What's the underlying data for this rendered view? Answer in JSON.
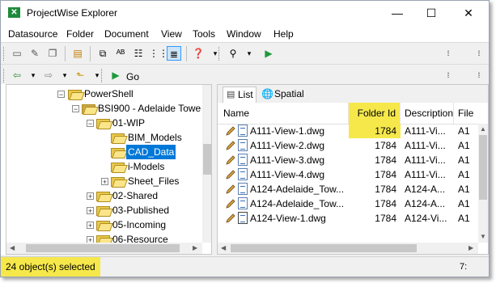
{
  "window": {
    "title": "ProjectWise Explorer",
    "minimize": "—",
    "maximize": "☐",
    "close": "✕"
  },
  "menu": [
    "Datasource",
    "Folder",
    "Document",
    "View",
    "Tools",
    "Window",
    "Help"
  ],
  "nav": {
    "go_label": "Go"
  },
  "tree": {
    "items": [
      {
        "label": "PowerShell",
        "expander": "−"
      },
      {
        "label": "BSI900 - Adelaide Towe",
        "expander": "−"
      },
      {
        "label": "01-WIP",
        "expander": "−"
      },
      {
        "label": "BIM_Models",
        "expander": ""
      },
      {
        "label": "CAD_Data",
        "expander": "",
        "selected": true
      },
      {
        "label": "i-Models",
        "expander": ""
      },
      {
        "label": "Sheet_Files",
        "expander": "+"
      },
      {
        "label": "02-Shared",
        "expander": "+"
      },
      {
        "label": "03-Published",
        "expander": "+"
      },
      {
        "label": "05-Incoming",
        "expander": "+"
      },
      {
        "label": "06-Resource",
        "expander": "+"
      }
    ]
  },
  "tabs": [
    {
      "label": "List"
    },
    {
      "label": "Spatial"
    }
  ],
  "columns": {
    "name": "Name",
    "folder_id": "Folder Id",
    "description": "Description",
    "file": "File"
  },
  "rows": [
    {
      "name": "A111-View-1.dwg",
      "folder_id": "1784",
      "description": "A111-Vi...",
      "file": "A1"
    },
    {
      "name": "A111-View-2.dwg",
      "folder_id": "1784",
      "description": "A111-Vi...",
      "file": "A1"
    },
    {
      "name": "A111-View-3.dwg",
      "folder_id": "1784",
      "description": "A111-Vi...",
      "file": "A1"
    },
    {
      "name": "A111-View-4.dwg",
      "folder_id": "1784",
      "description": "A111-Vi...",
      "file": "A1"
    },
    {
      "name": "A124-Adelaide_Tow...",
      "folder_id": "1784",
      "description": "A124-A...",
      "file": "A1"
    },
    {
      "name": "A124-Adelaide_Tow...",
      "folder_id": "1784",
      "description": "A124-A...",
      "file": "A1"
    },
    {
      "name": "A124-View-1.dwg",
      "folder_id": "1784",
      "description": "A124-Vi...",
      "file": "A1"
    }
  ],
  "status": {
    "text": "24 object(s) selected",
    "right": "7:"
  },
  "colors": {
    "highlight": "#f6e84b",
    "selection": "#0078d7",
    "accent_green": "#1e8a3c"
  }
}
